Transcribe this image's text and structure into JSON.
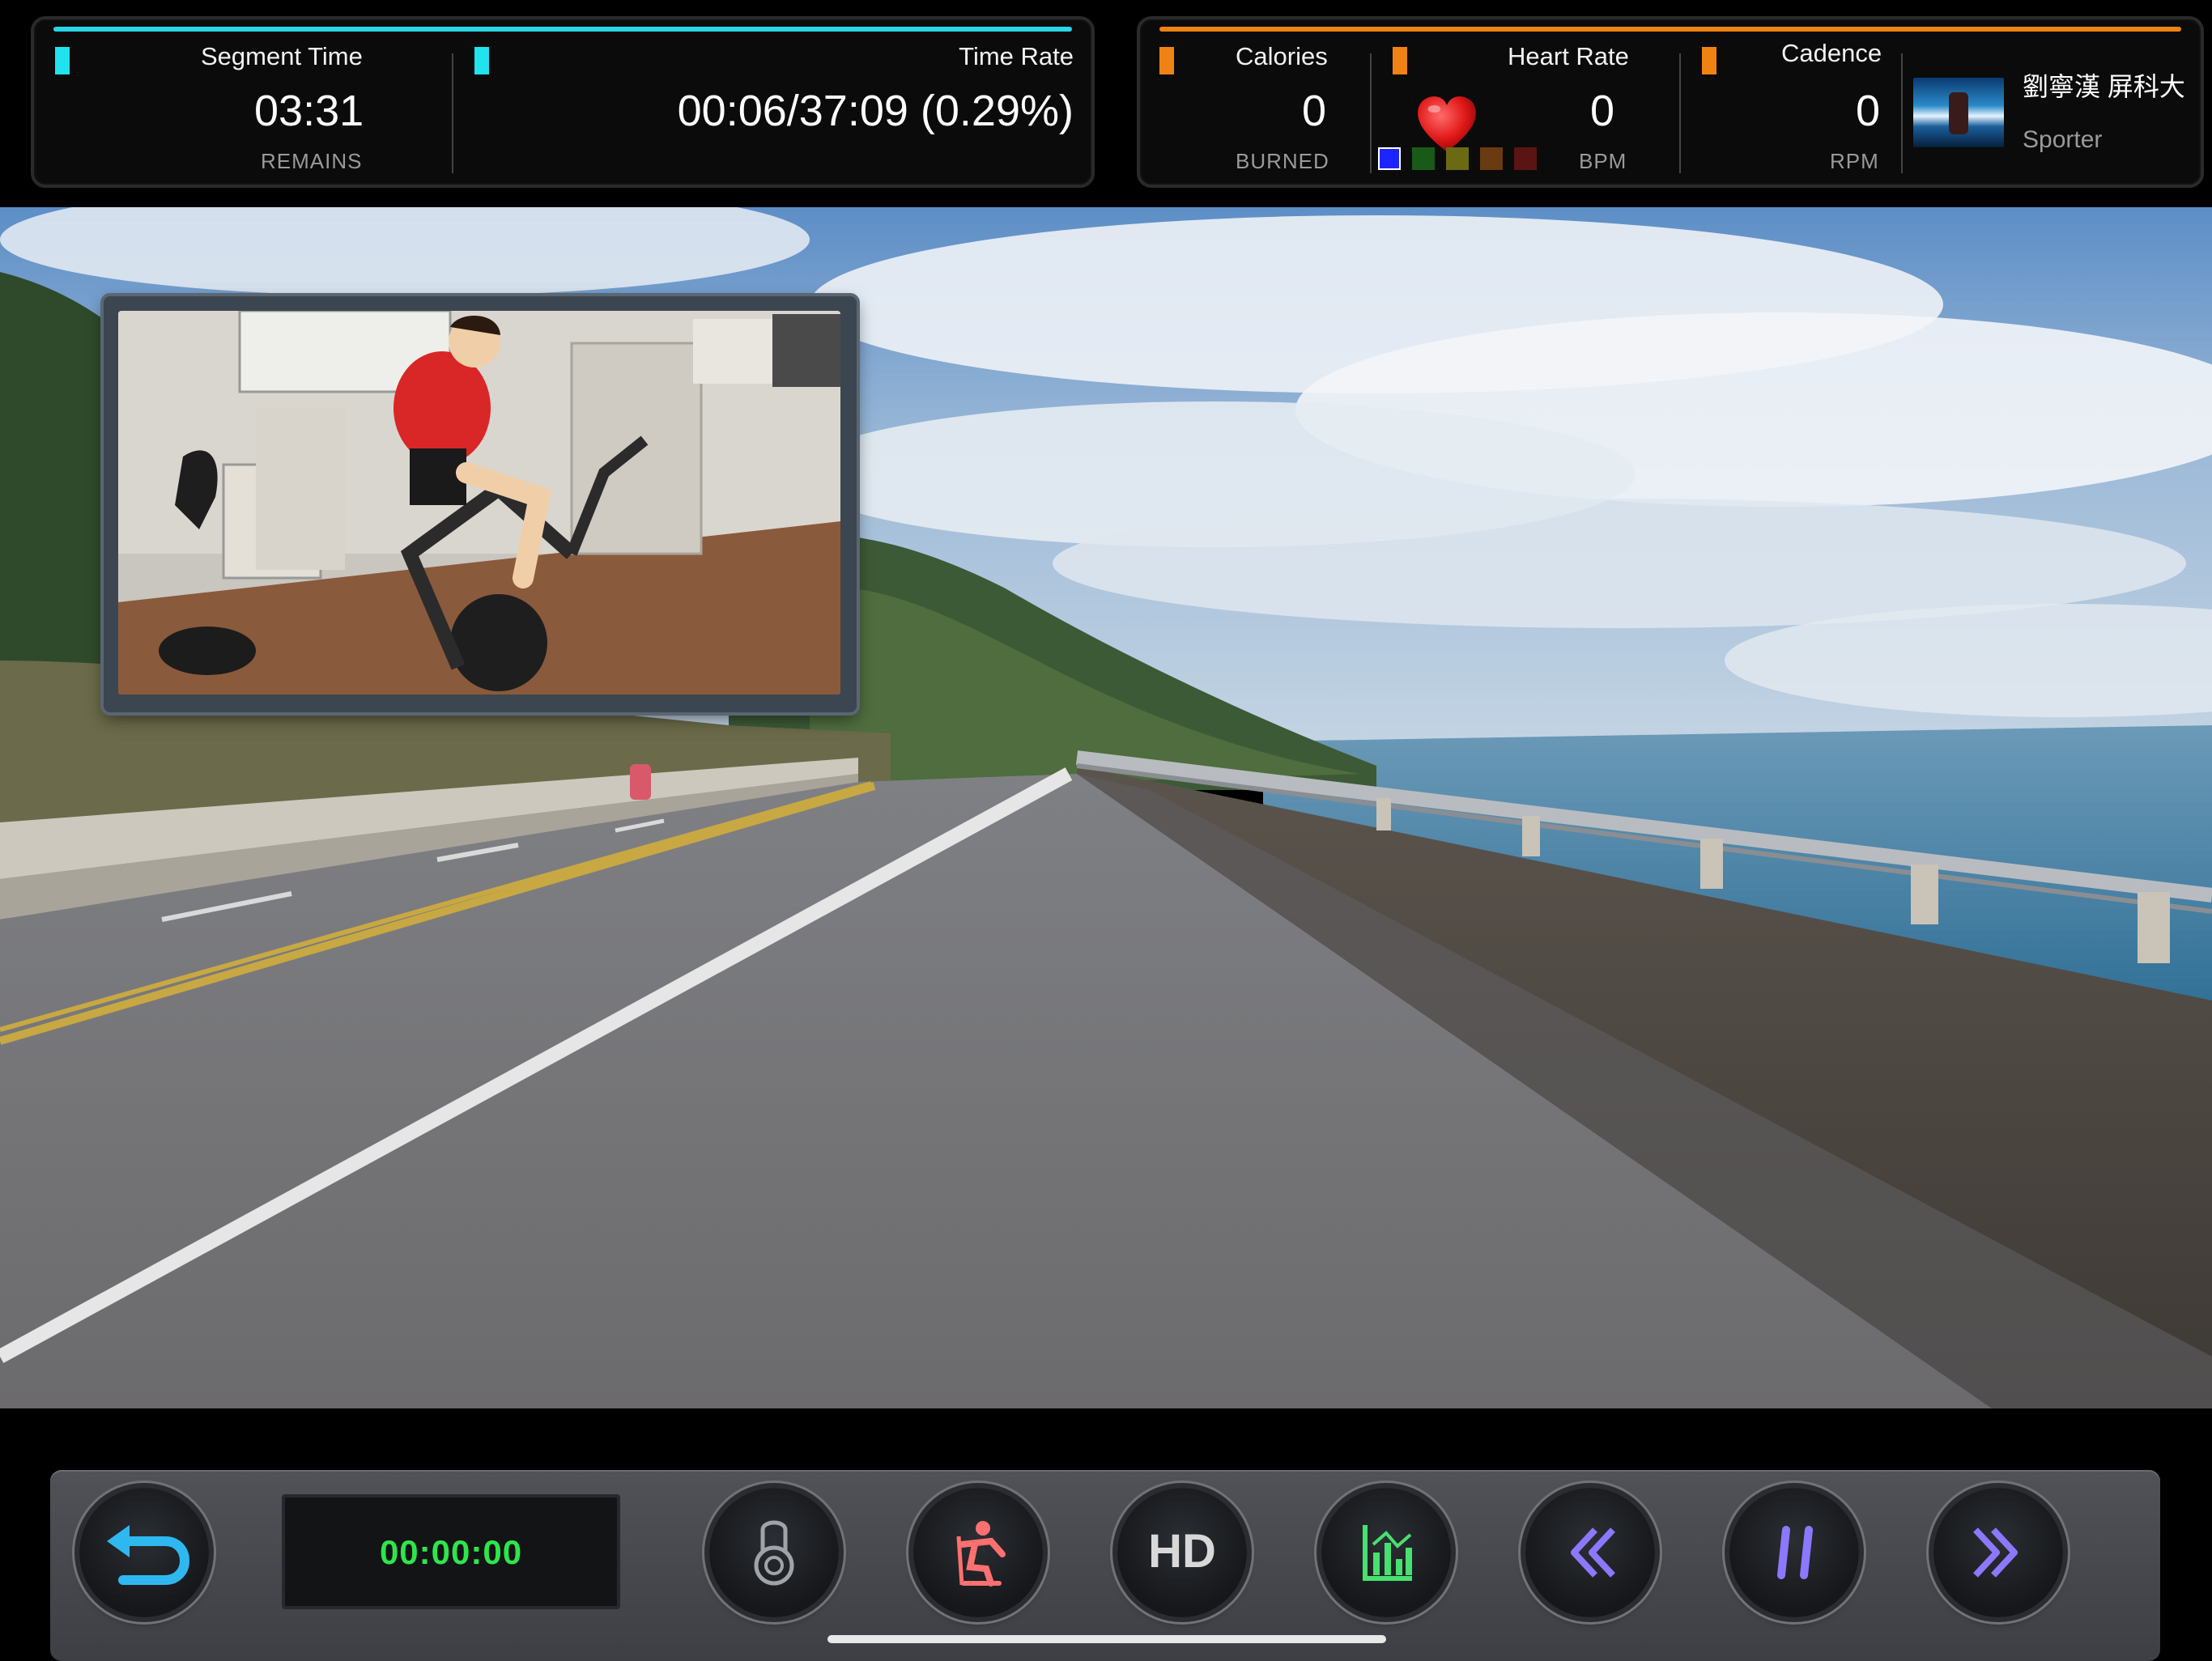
{
  "header": {
    "segment": {
      "label": "Segment Time",
      "value": "03:31",
      "unit": "REMAINS",
      "marker_color": "#22e2ee"
    },
    "time_rate": {
      "label": "Time Rate",
      "value": "00:06/37:09 (0.29%)",
      "marker_color": "#22e2ee"
    },
    "calories": {
      "label": "Calories",
      "value": "0",
      "unit": "BURNED",
      "marker_color": "#f08214"
    },
    "heart_rate": {
      "label": "Heart Rate",
      "value": "0",
      "unit": "BPM",
      "icon": "heart-icon",
      "zones": [
        "#1e24ff",
        "#1a5a18",
        "#6a6a12",
        "#6a3a10",
        "#5a1414"
      ]
    },
    "cadence": {
      "label": "Cadence",
      "value": "0",
      "unit": "RPM",
      "marker_color": "#f08214"
    },
    "user": {
      "name": "劉寧漢 屏科大",
      "role": "Sporter"
    }
  },
  "controls": {
    "timer": "00:00:00",
    "buttons": [
      {
        "name": "back-button",
        "icon": "undo-arrow-icon",
        "color": "#2fb8ef"
      },
      {
        "name": "resistance-button",
        "icon": "knob-icon",
        "color": "#a0a4aa"
      },
      {
        "name": "bike-mode-button",
        "icon": "cyclist-icon",
        "color": "#ff7070"
      },
      {
        "name": "hd-button",
        "icon": "hd-icon",
        "label": "HD",
        "color": "#d8d8d8"
      },
      {
        "name": "stats-button",
        "icon": "bar-chart-icon",
        "color": "#48e070"
      },
      {
        "name": "rewind-button",
        "icon": "rewind-icon",
        "color": "#8c78ff"
      },
      {
        "name": "pause-button",
        "icon": "pause-icon",
        "color": "#8c78ff"
      },
      {
        "name": "fast-forward-button",
        "icon": "fast-forward-icon",
        "color": "#8c78ff"
      }
    ]
  }
}
